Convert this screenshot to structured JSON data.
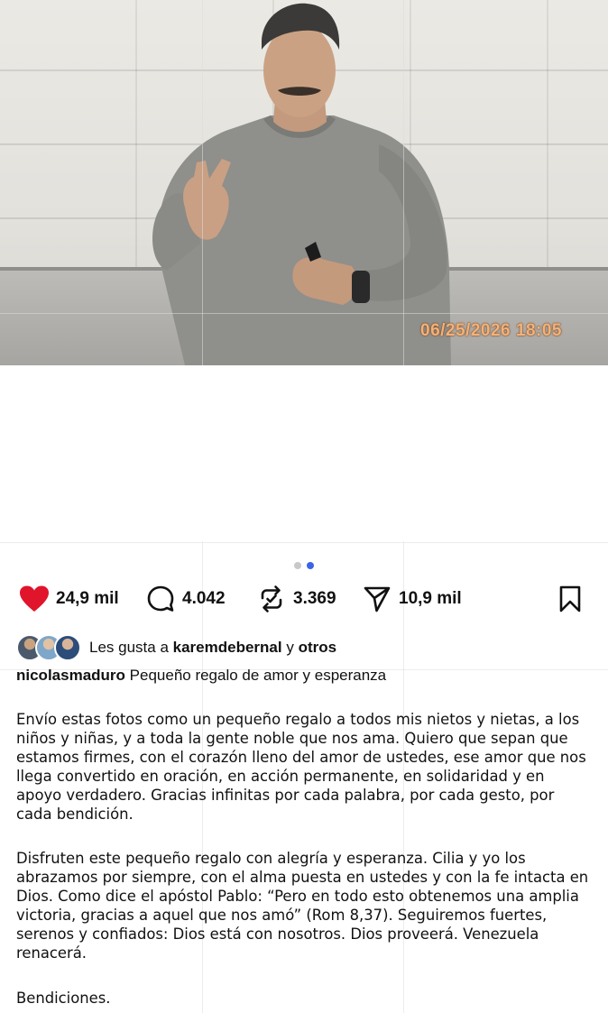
{
  "photo": {
    "timestamp": "06/25/2026  18:05"
  },
  "carousel": {
    "total": 2,
    "active_index": 1
  },
  "actions": {
    "likes": "24,9 mil",
    "comments": "4.042",
    "reposts": "3.369",
    "shares": "10,9 mil",
    "like_color": "#e0142a",
    "icons": [
      "heart-icon",
      "comment-icon",
      "repost-icon",
      "send-icon",
      "bookmark-icon"
    ]
  },
  "liked_by": {
    "prefix": "Les gusta a",
    "user": "karemdebernal",
    "connector": "y",
    "others": "otros"
  },
  "post": {
    "username": "nicolasmaduro",
    "title": "Pequeño regalo de amor y esperanza",
    "paragraph_1": "Envío estas fotos como un pequeño regalo a todos mis nietos y nietas, a los niños y niñas, y a toda la gente noble que nos ama. Quiero que sepan que estamos firmes, con el corazón lleno del amor de ustedes, ese amor que nos llega convertido en oración, en acción permanente, en solidaridad y en apoyo verdadero. Gracias infinitas por cada palabra, por cada gesto, por cada bendición.",
    "paragraph_2": "Disfruten este pequeño regalo con alegría y esperanza. Cilia y yo los abrazamos por siempre, con el alma puesta en ustedes y con la fe intacta en Dios. Como dice el apóstol Pablo: “Pero en todo esto obtenemos una amplia victoria, gracias a aquel que nos amó” (Rom 8,37). Seguiremos fuertes, serenos y confiados: Dios está con nosotros. Dios proveerá. Venezuela renacerá.",
    "paragraph_3": "Bendiciones."
  }
}
